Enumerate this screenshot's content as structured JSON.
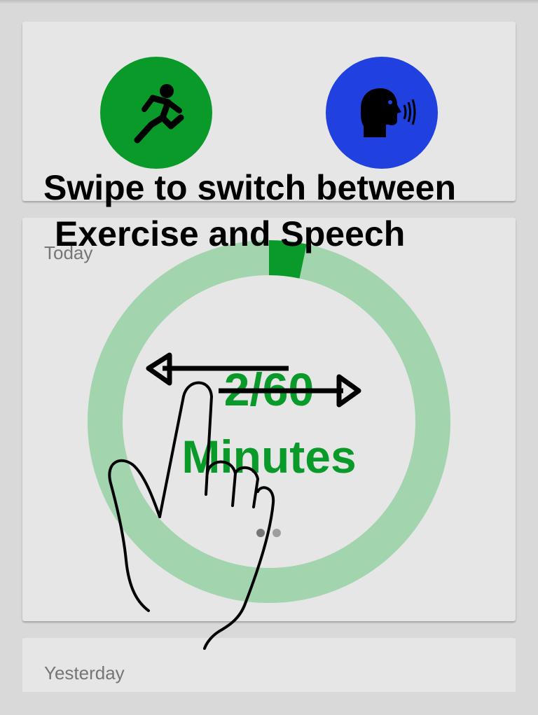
{
  "colors": {
    "exercise": "#0a9a2a",
    "speech": "#2040e0",
    "ring_track": "#a2d4ad",
    "ring_progress": "#0a9a2a",
    "text_green": "#0a9a2a",
    "dot_active": "#757575",
    "dot_inactive": "#9e9e9e"
  },
  "mode_selector": {
    "exercise": {
      "icon": "running-person-icon",
      "color": "#0a9a2a"
    },
    "speech": {
      "icon": "speaking-head-icon",
      "color": "#2040e0"
    }
  },
  "today": {
    "label": "Today",
    "minutes_done": 2,
    "minutes_goal": 60,
    "progress_text": "2/60",
    "unit_text": "Minutes",
    "page_indicator": {
      "count": 2,
      "active": 0
    }
  },
  "yesterday": {
    "label": "Yesterday"
  },
  "tutorial_overlay": {
    "line1": "Swipe to switch between",
    "line2": "Exercise and Speech",
    "icons": [
      "double-arrow-icon",
      "pointing-hand-icon"
    ]
  }
}
